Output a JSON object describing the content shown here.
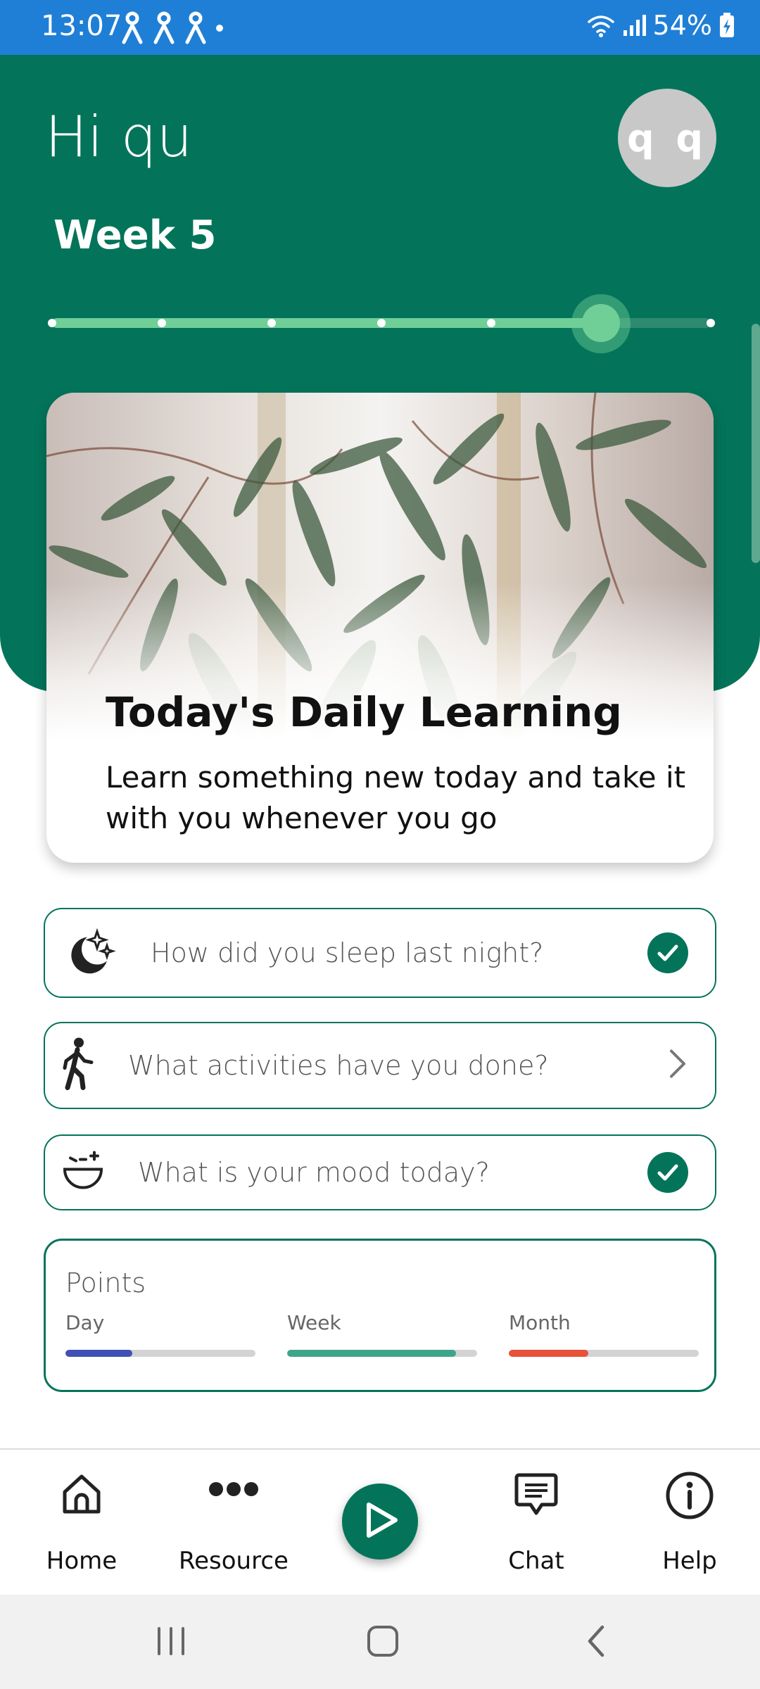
{
  "status_bar": {
    "time": "13:07",
    "battery": "54%"
  },
  "header": {
    "greeting": "Hi qu",
    "avatar_initials": "q q",
    "week_label": "Week 5",
    "week_progress": {
      "total_steps": 7,
      "current_step": 6
    }
  },
  "daily_learning": {
    "title": "Today's Daily Learning",
    "description": "Learn something new today and take it with you whenever you go"
  },
  "questions": [
    {
      "icon": "moon-stars-icon",
      "text": "How did you sleep last night?",
      "status": "done"
    },
    {
      "icon": "walking-person-icon",
      "text": "What activities have you done?",
      "status": "open"
    },
    {
      "icon": "mood-face-icon",
      "text": "What is your mood today?",
      "status": "done"
    }
  ],
  "points": {
    "title": "Points",
    "periods": [
      {
        "label": "Day",
        "fraction": 0.35,
        "color": "#3f51b5"
      },
      {
        "label": "Week",
        "fraction": 0.89,
        "color": "#3fa58a"
      },
      {
        "label": "Month",
        "fraction": 0.42,
        "color": "#e8513a"
      }
    ]
  },
  "bottom_nav": {
    "home": "Home",
    "resource": "Resource",
    "chat": "Chat",
    "help": "Help"
  },
  "colors": {
    "primary": "#03745a",
    "status_bar": "#1f7fd6",
    "slider_active": "#6fcf97"
  }
}
